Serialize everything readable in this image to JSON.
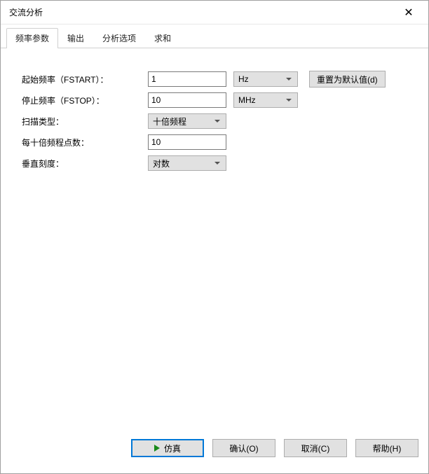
{
  "window": {
    "title": "交流分析"
  },
  "tabs": {
    "t0": "频率参数",
    "t1": "输出",
    "t2": "分析选项",
    "t3": "求和"
  },
  "form": {
    "fstart_label": "起始频率（FSTART）：",
    "fstart_value": "1",
    "fstart_unit": "Hz",
    "fstop_label": "停止频率（FSTOP）：",
    "fstop_value": "10",
    "fstop_unit": "MHz",
    "sweep_label": "扫描类型：",
    "sweep_value": "十倍频程",
    "points_label": "每十倍频程点数：",
    "points_value": "10",
    "vscale_label": "垂直刻度：",
    "vscale_value": "对数",
    "reset": "重置为默认值(d)"
  },
  "footer": {
    "run": "仿真",
    "ok": "确认(O)",
    "cancel": "取消(C)",
    "help": "帮助(H)"
  }
}
